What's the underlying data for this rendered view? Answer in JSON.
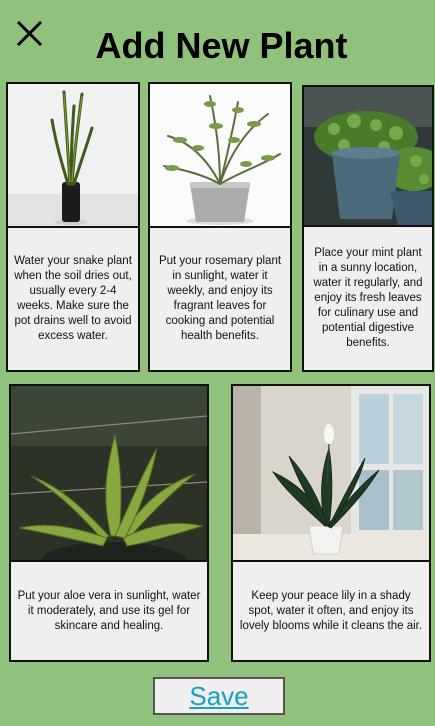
{
  "header": {
    "title": "Add New Plant",
    "close_icon": "close-icon"
  },
  "plants": [
    {
      "name": "snake-plant",
      "care_text": "Water your snake plant when the soil dries out, usually every 2-4 weeks. Make sure the pot drains well to avoid excess water."
    },
    {
      "name": "rosemary",
      "care_text": "Put your rosemary plant in sunlight, water it weekly, and enjoy its fragrant leaves for cooking and potential health benefits."
    },
    {
      "name": "mint",
      "care_text": "Place your mint plant in a sunny location, water it regularly, and enjoy its fresh leaves for culinary use and potential digestive benefits."
    },
    {
      "name": "aloe-vera",
      "care_text": "Put your aloe vera in sunlight, water it moderately, and use its gel for skincare and healing."
    },
    {
      "name": "peace-lily",
      "care_text": "Keep your peace lily in a shady spot, water it often, and enjoy its lovely blooms while it cleans the air."
    }
  ],
  "footer": {
    "save_label": "Save"
  },
  "colors": {
    "background": "#91c27d",
    "card": "#efefef",
    "save_text": "#1a9fbf"
  }
}
